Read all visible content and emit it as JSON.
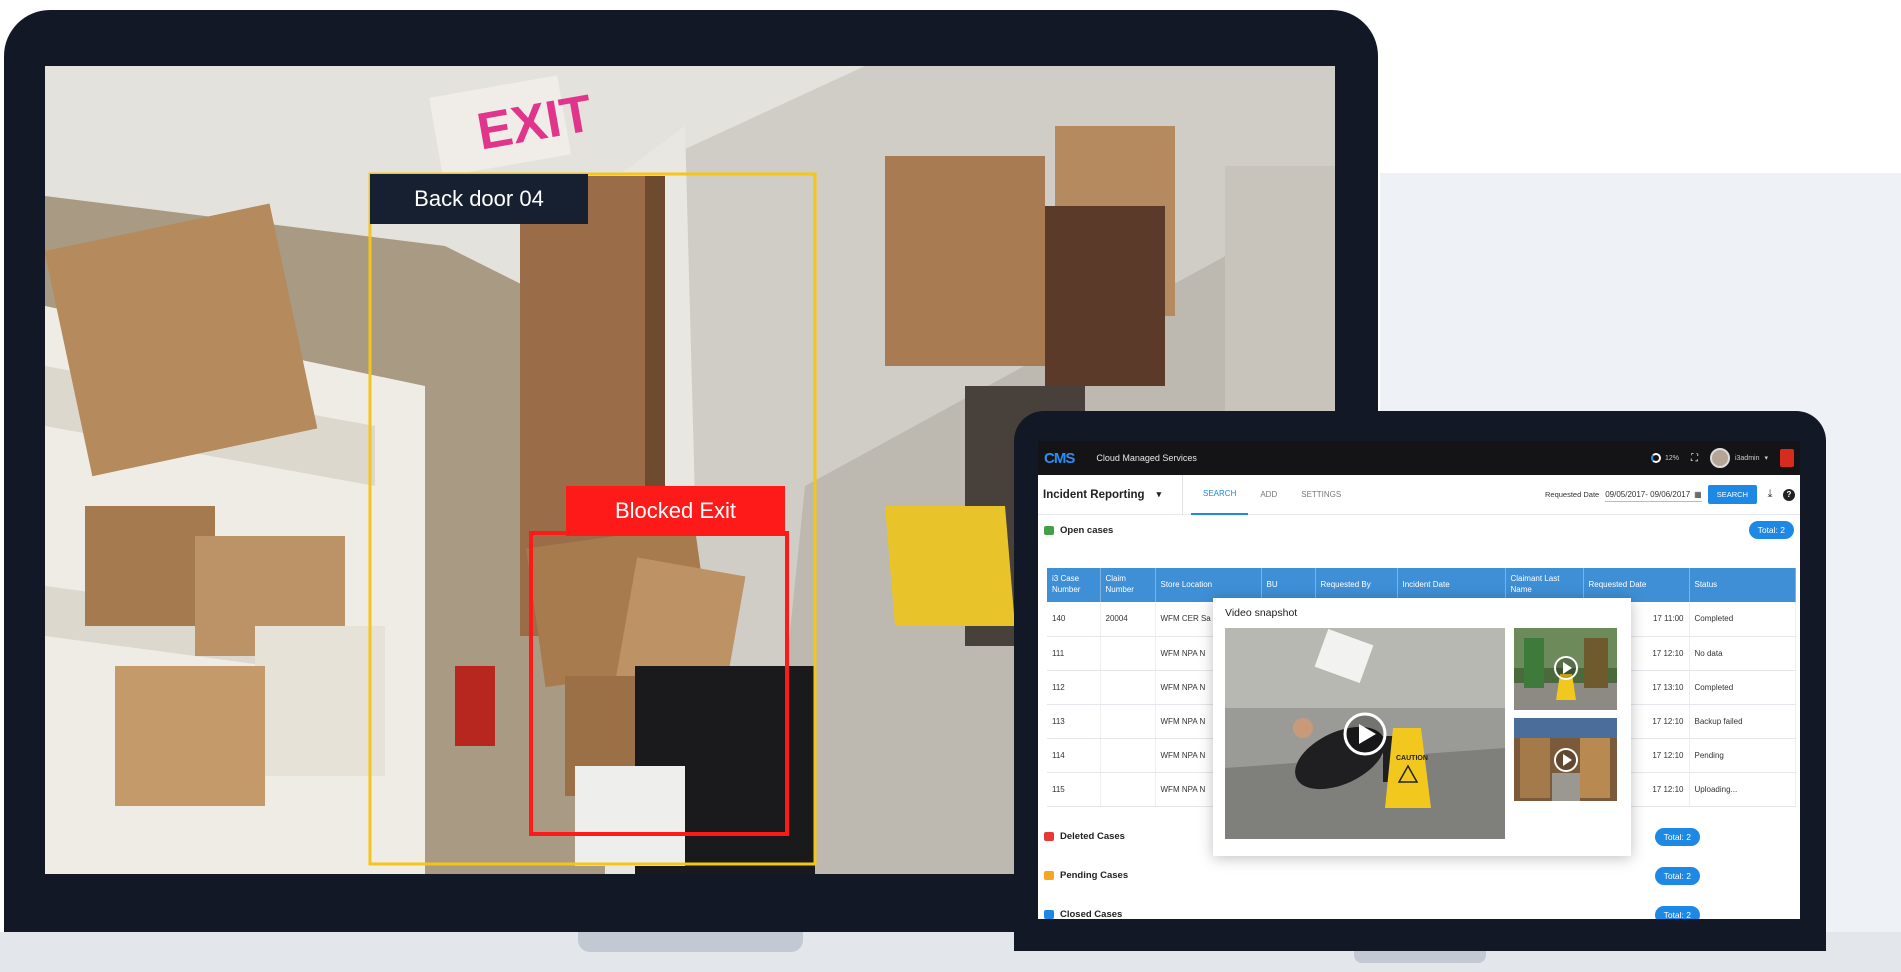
{
  "camera": {
    "exit_sign": "EXIT",
    "detections": [
      {
        "label": "Back door 04",
        "color": "#f5c518"
      },
      {
        "label": "Blocked Exit",
        "color": "#ff1a1a"
      }
    ]
  },
  "app": {
    "logo": "CMS",
    "title": "Cloud Managed Services",
    "progress": "12%",
    "progress_value": 0.12,
    "user": "i3admin",
    "module": "Incident Reporting",
    "tabs": [
      {
        "label": "SEARCH",
        "active": true
      },
      {
        "label": "ADD",
        "active": false
      },
      {
        "label": "SETTINGS",
        "active": false
      }
    ],
    "requested_date_label": "Requested Date",
    "requested_date_value": "09/05/2017- 09/06/2017",
    "search_button": "SEARCH",
    "icons": {
      "download": "download-icon",
      "help": "help-icon",
      "calendar": "calendar-icon"
    },
    "open_cases": {
      "title": "Open cases",
      "total": "Total: 2",
      "color": "#43a047"
    },
    "table": {
      "headers": [
        "i3 Case Number",
        "Claim Number",
        "Store Location",
        "BU",
        "Requested By",
        "Incident Date",
        "Claimant Last Name",
        "Requested Date",
        "Status"
      ],
      "rows": [
        {
          "case": "140",
          "claim": "20004",
          "store": "WFM CER Sa",
          "req_date": "17 11:00",
          "status": "Completed",
          "status_class": "st-completed"
        },
        {
          "case": "111",
          "claim": "",
          "store": "WFM NPA N",
          "req_date": "17 12:10",
          "status": "No data",
          "status_class": "st-nodata"
        },
        {
          "case": "112",
          "claim": "",
          "store": "WFM NPA N",
          "req_date": "17 13:10",
          "status": "Completed",
          "status_class": "st-completed"
        },
        {
          "case": "113",
          "claim": "",
          "store": "WFM NPA N",
          "req_date": "17 12:10",
          "status": "Backup failed",
          "status_class": "st-failed"
        },
        {
          "case": "114",
          "claim": "",
          "store": "WFM NPA N",
          "req_date": "17 12:10",
          "status": "Pending",
          "status_class": "st-pending"
        },
        {
          "case": "115",
          "claim": "",
          "store": "WFM NPA N",
          "req_date": "17 12:10",
          "status": "Uploading...",
          "status_class": "st-upload"
        }
      ]
    },
    "video_snapshot": {
      "title": "Video snapshot",
      "caution_sign": "CAUTION"
    },
    "sections": [
      {
        "title": "Deleted Cases",
        "total": "Total: 2",
        "color": "#e53935"
      },
      {
        "title": "Pending Cases",
        "total": "Total: 2",
        "color": "#f5a623"
      },
      {
        "title": "Closed Cases",
        "total": "Total: 2",
        "color": "#1e88e5"
      }
    ]
  }
}
